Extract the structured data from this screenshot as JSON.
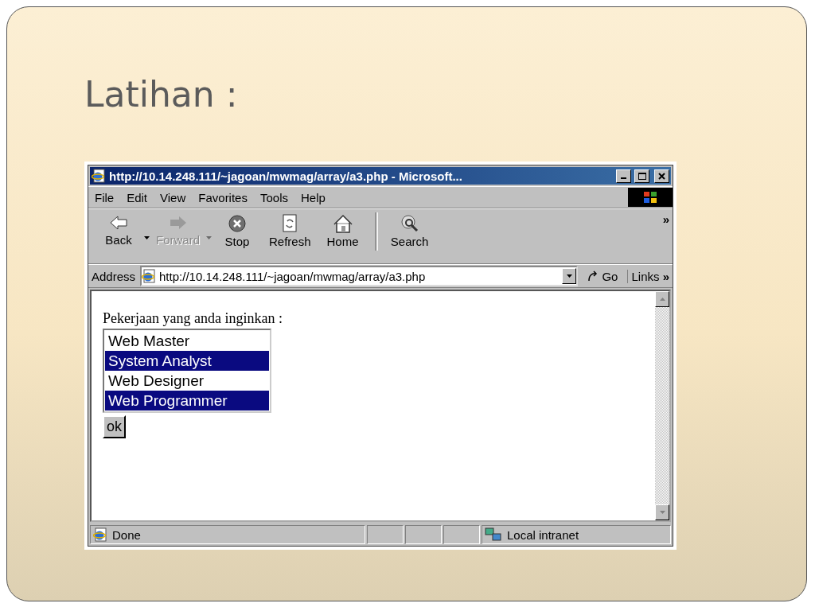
{
  "slide": {
    "title": "Latihan :"
  },
  "browser": {
    "title": "http://10.14.248.111/~jagoan/mwmag/array/a3.php - Microsoft...",
    "menu": [
      "File",
      "Edit",
      "View",
      "Favorites",
      "Tools",
      "Help"
    ],
    "toolbar": [
      {
        "kind": "back",
        "label": "Back",
        "disabled": false,
        "dropdown": true
      },
      {
        "kind": "forward",
        "label": "Forward",
        "disabled": true,
        "dropdown": true
      },
      {
        "kind": "stop",
        "label": "Stop",
        "disabled": false,
        "dropdown": false
      },
      {
        "kind": "refresh",
        "label": "Refresh",
        "disabled": false,
        "dropdown": false
      },
      {
        "kind": "home",
        "label": "Home",
        "disabled": false,
        "dropdown": false
      },
      {
        "kind": "search",
        "label": "Search",
        "disabled": false,
        "dropdown": false
      }
    ],
    "toolbar_more": "»",
    "address": {
      "label": "Address",
      "value": "http://10.14.248.111/~jagoan/mwmag/array/a3.php",
      "go": "Go",
      "links": "Links",
      "links_more": "»"
    },
    "page": {
      "prompt": "Pekerjaan yang anda inginkan :",
      "options": [
        {
          "label": "Web Master",
          "selected": false
        },
        {
          "label": "System Analyst",
          "selected": true
        },
        {
          "label": "Web Designer",
          "selected": false
        },
        {
          "label": "Web Programmer",
          "selected": true
        }
      ],
      "button": "ok"
    },
    "status_bar": {
      "text": "Done",
      "zone": "Local intranet"
    }
  }
}
